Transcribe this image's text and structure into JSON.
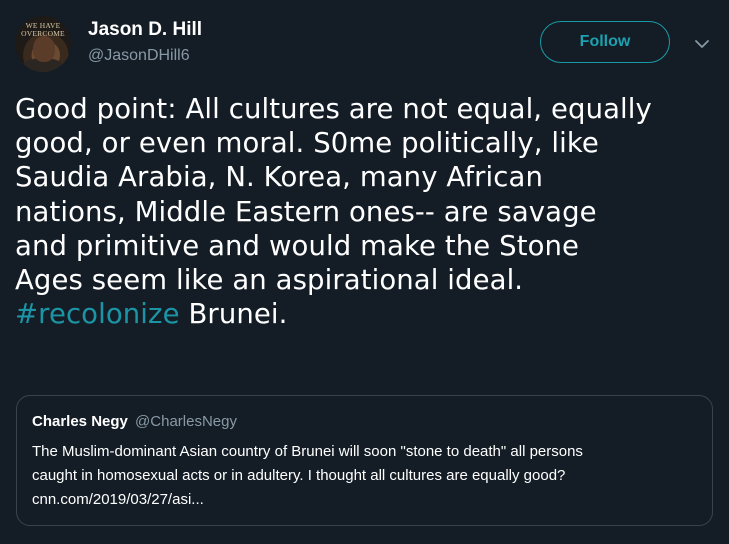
{
  "author": {
    "display_name": "Jason D. Hill",
    "handle": "@JasonDHill6",
    "avatar_text": [
      "WE HAVE",
      "OVERCOME"
    ]
  },
  "follow_button": {
    "label": "Follow"
  },
  "menu": {
    "icon": "chevron-down-icon"
  },
  "tweet": {
    "lines": [
      "Good point: All cultures are not equal, equally",
      "good, or even moral. S0me politically, like",
      "Saudia Arabia, N. Korea, many African",
      "nations, Middle Eastern ones-- are savage",
      "and primitive and would make the Stone",
      "Ages seem like an aspirational ideal."
    ],
    "hashtag": "#recolonize",
    "after_hashtag": " Brunei."
  },
  "quoted_tweet": {
    "display_name": "Charles Negy",
    "handle": "@CharlesNegy",
    "lines": [
      "The Muslim-dominant Asian country of Brunei will soon \"stone to death\" all persons",
      "caught in homosexual acts or in adultery. I thought all cultures are equally good?",
      "cnn.com/2019/03/27/asi..."
    ]
  },
  "colors": {
    "background": "#141d26",
    "accent": "#1b95a5",
    "secondary_text": "#8899a6",
    "border": "#38444d"
  }
}
